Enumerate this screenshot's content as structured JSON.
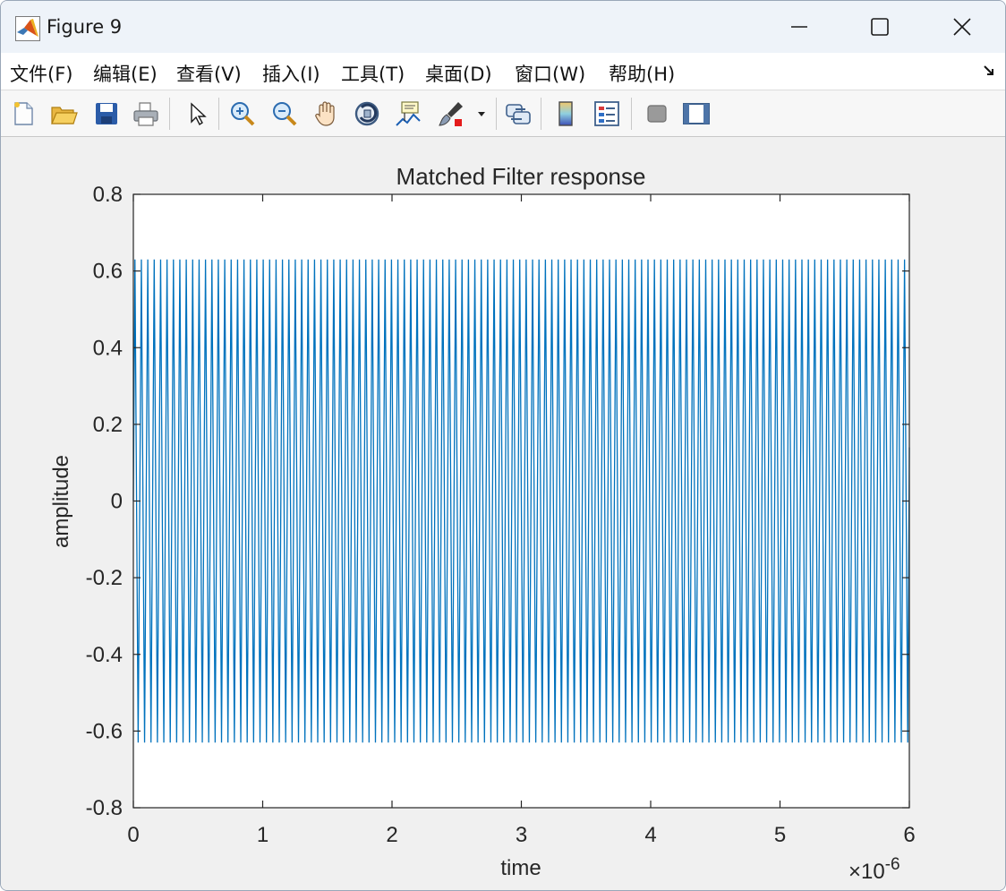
{
  "window": {
    "title": "Figure 9",
    "controls": {
      "minimize": "minimize",
      "maximize": "maximize",
      "close": "close"
    }
  },
  "menu": {
    "items": [
      {
        "label": "文件(F)"
      },
      {
        "label": "编辑(E)"
      },
      {
        "label": "查看(V)"
      },
      {
        "label": "插入(I)"
      },
      {
        "label": "工具(T)"
      },
      {
        "label": "桌面(D)"
      },
      {
        "label": "窗口(W)"
      },
      {
        "label": "帮助(H)"
      }
    ]
  },
  "toolbar": {
    "icons": [
      "new-figure-icon",
      "open-file-icon",
      "save-icon",
      "print-icon",
      "edit-plot-icon",
      "zoom-in-icon",
      "zoom-out-icon",
      "pan-icon",
      "rotate-3d-icon",
      "data-cursor-icon",
      "brush-icon",
      "brush-dropdown-icon",
      "link-plot-icon",
      "insert-colorbar-icon",
      "insert-legend-icon",
      "hide-plot-tools-icon",
      "show-plot-tools-icon"
    ]
  },
  "chart_data": {
    "type": "line",
    "title": "Matched Filter response",
    "xlabel": "time",
    "ylabel": "amplitude",
    "xlim": [
      0,
      6e-06
    ],
    "ylim": [
      -0.8,
      0.8
    ],
    "x_ticks": [
      "0",
      "1",
      "2",
      "3",
      "4",
      "5",
      "6"
    ],
    "y_ticks": [
      "-0.8",
      "-0.6",
      "-0.4",
      "-0.2",
      "0",
      "0.2",
      "0.4",
      "0.6",
      "0.8"
    ],
    "x_exponent_label": "×10",
    "x_exponent_power": "-6",
    "series": [
      {
        "color": "#0072bd",
        "signal": "oscillation",
        "amplitude": 0.63,
        "cycles": 121,
        "x_start": 0,
        "x_end": 6e-06,
        "final_value": 0.14
      }
    ],
    "grid": false,
    "legend": "none"
  }
}
